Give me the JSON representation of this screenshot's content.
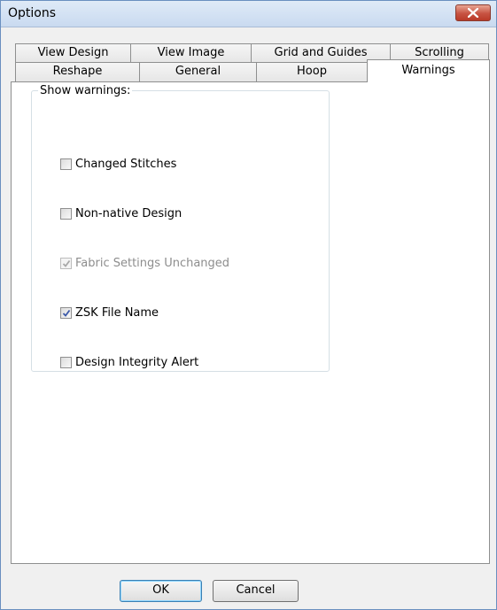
{
  "window": {
    "title": "Options",
    "close_icon": "close-x-icon"
  },
  "tabs": {
    "row1": [
      "View Design",
      "View Image",
      "Grid and Guides",
      "Scrolling"
    ],
    "row2": [
      "Reshape",
      "General",
      "Hoop",
      "Warnings"
    ],
    "active": "Warnings"
  },
  "warnings": {
    "group_label": "Show warnings:",
    "items": [
      {
        "label": "Changed Stitches",
        "checked": false,
        "enabled": true
      },
      {
        "label": "Non-native Design",
        "checked": false,
        "enabled": true
      },
      {
        "label": "Fabric Settings Unchanged",
        "checked": true,
        "enabled": false
      },
      {
        "label": "ZSK File Name",
        "checked": true,
        "enabled": true
      },
      {
        "label": "Design Integrity Alert",
        "checked": false,
        "enabled": true
      }
    ]
  },
  "buttons": {
    "ok": "OK",
    "cancel": "Cancel"
  }
}
